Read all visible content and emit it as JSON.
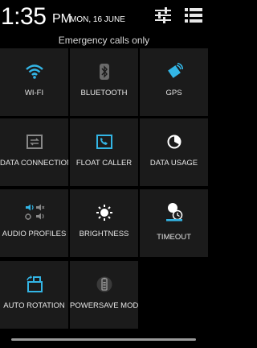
{
  "header": {
    "time": "1:35",
    "ampm": "PM",
    "date": "MON, 16 JUNE",
    "status": "Emergency calls only"
  },
  "colors": {
    "accent": "#33b5e5",
    "inactive": "#888888"
  },
  "tiles": [
    {
      "label": "WI-FI",
      "icon": "wifi-icon",
      "active": true
    },
    {
      "label": "BLUETOOTH",
      "icon": "bluetooth-icon",
      "active": false
    },
    {
      "label": "GPS",
      "icon": "gps-icon",
      "active": true
    },
    {
      "label": "DATA CONNECTION",
      "icon": "data-connection-icon",
      "active": false
    },
    {
      "label": "FLOAT CALLER",
      "icon": "float-caller-icon",
      "active": true
    },
    {
      "label": "DATA USAGE",
      "icon": "data-usage-icon",
      "active": false
    },
    {
      "label": "AUDIO PROFILES",
      "icon": "audio-profiles-icon",
      "active": true
    },
    {
      "label": "BRIGHTNESS",
      "icon": "brightness-icon",
      "active": false
    },
    {
      "label": "TIMEOUT",
      "icon": "timeout-icon",
      "active": false
    },
    {
      "label": "AUTO ROTATION",
      "icon": "auto-rotation-icon",
      "active": true
    },
    {
      "label": "POWERSAVE MODE",
      "icon": "powersave-icon",
      "active": false
    }
  ]
}
